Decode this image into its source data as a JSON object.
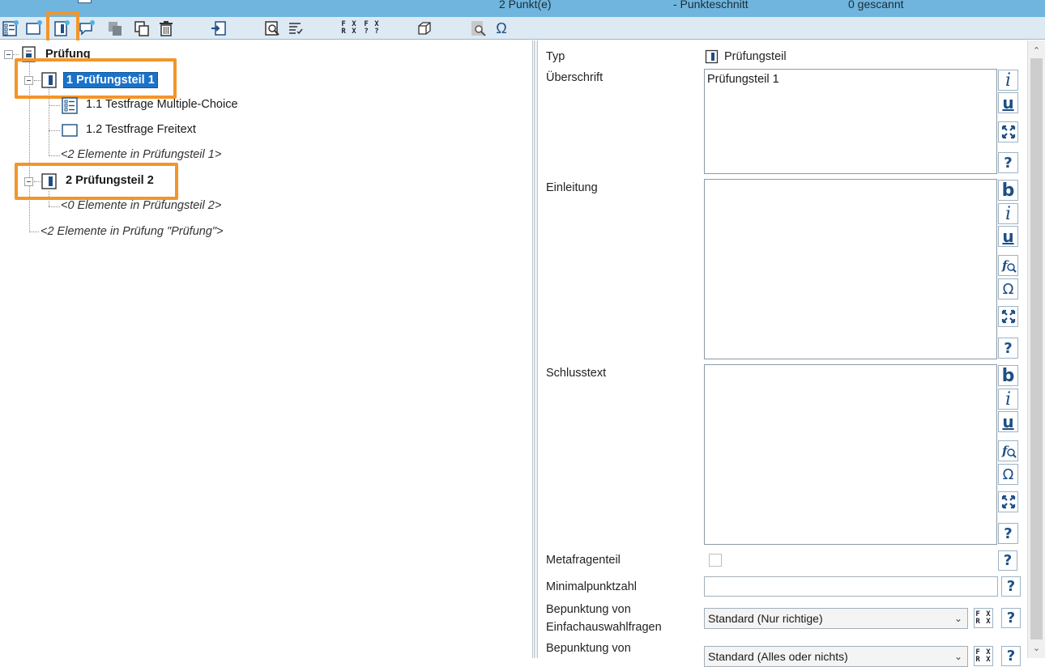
{
  "status_bar": {
    "points": "2 Punkt(e)",
    "average": "- Punkteschnitt",
    "scanned": "0 gescannt"
  },
  "toolbar": {
    "buttons": [
      "add-multiple-choice-icon",
      "add-freetext-icon",
      "add-section-icon",
      "add-comment-icon",
      "copy-gray-icon",
      "duplicate-icon",
      "delete-icon",
      "import-icon",
      "preview-icon",
      "checklist-icon",
      "formula-fx-rx-icon",
      "formula-fx-q-icon",
      "cube-icon",
      "formula-search-icon",
      "omega-icon"
    ],
    "fx_labels": {
      "a_top": "F X",
      "a_bottom": "R X",
      "b_top": "F X",
      "b_bottom": "? ?"
    },
    "omega": "Ω"
  },
  "tree": {
    "root": {
      "label": "Prüfung",
      "icon": "exam-doc-icon"
    },
    "section1": {
      "label": "1 Prüfungsteil 1",
      "icon": "section-icon",
      "selected": true
    },
    "q1": {
      "label": "1.1 Testfrage Multiple-Choice",
      "icon": "multiple-choice-icon"
    },
    "q2": {
      "label": "1.2 Testfrage Freitext",
      "icon": "freetext-icon"
    },
    "section1_summary": "<2 Elemente in Prüfungsteil 1>",
    "section2": {
      "label": "2 Prüfungsteil 2",
      "icon": "section-icon"
    },
    "section2_summary": "<0 Elemente in Prüfungsteil 2>",
    "root_summary": "<2 Elemente in Prüfung \"Prüfung\">"
  },
  "props": {
    "type_label": "Typ",
    "type_value": "Prüfungsteil",
    "heading_label": "Überschrift",
    "heading_value": "Prüfungsteil 1",
    "intro_label": "Einleitung",
    "intro_value": "",
    "closing_label": "Schlusstext",
    "closing_value": "",
    "meta_label": "Metafragenteil",
    "meta_checked": false,
    "minpoints_label": "Minimalpunktzahl",
    "minpoints_value": "",
    "scoring_single_label_1": "Bepunktung von",
    "scoring_single_label_2": "Einfachauswahlfragen",
    "scoring_single_value": "Standard (Nur richtige)",
    "scoring_multi_label_1": "Bepunktung von",
    "scoring_multi_value": "Standard (Alles oder nichts)",
    "fmt": {
      "bold": "b",
      "italic": "i",
      "underline": "u",
      "help": "?",
      "omega": "Ω"
    }
  },
  "colors": {
    "status_bar": "#6fb5dd",
    "toolbar": "#dde9f3",
    "selection": "#1a73c9",
    "highlight": "#f3952a",
    "icon_blue": "#1d4f86"
  }
}
